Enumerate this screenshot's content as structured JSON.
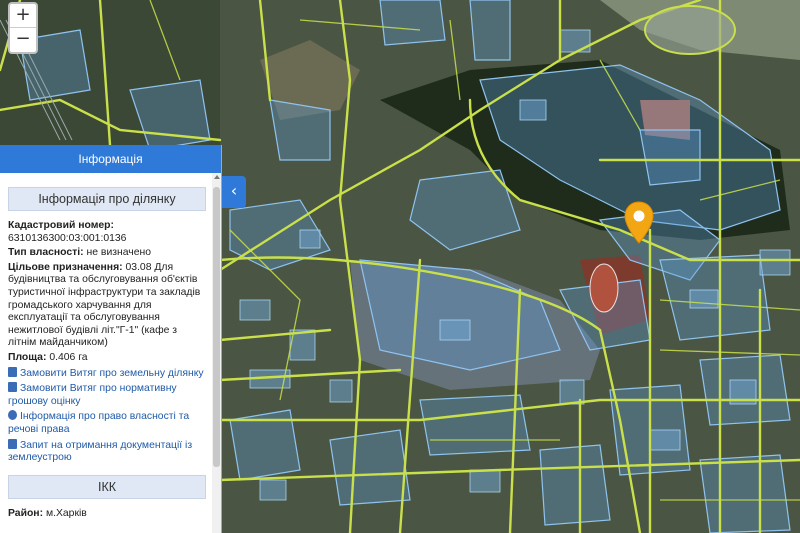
{
  "map": {
    "zoom_in": "+",
    "zoom_out": "−",
    "marker_icon": "location-pin-icon",
    "colors": {
      "parcel_fill": "#5b9bd5",
      "road_line": "#c9e04a",
      "marker": "#f2a614"
    }
  },
  "panel": {
    "header": "Інформація",
    "collapse_icon": "‹",
    "parcel_section_title": "Інформація про ділянку",
    "cadastral_label": "Кадастровий номер:",
    "cadastral_value": "6310136300:03:001:0136",
    "ownership_label": "Тип власності:",
    "ownership_value": "не визначено",
    "purpose_label": "Цільове призначення:",
    "purpose_value": "03.08 Для будівництва та обслуговування об'єктів туристичної інфраструктури та закладів громадського харчування для експлуатації та обслуговування нежитлової будівлі літ.\"Г-1\" (кафе з літнім майданчиком)",
    "area_label": "Площа:",
    "area_value": "0.406 га",
    "links": [
      "Замовити Витяг про земельну ділянку",
      "Замовити Витяг про нормативну грошову оцінку",
      "Інформація про право власності та речові права",
      "Запит на отримання документації із землеустрою"
    ],
    "ikk_section_title": "ІКК",
    "district_label": "Район:",
    "district_value": "м.Харків"
  }
}
